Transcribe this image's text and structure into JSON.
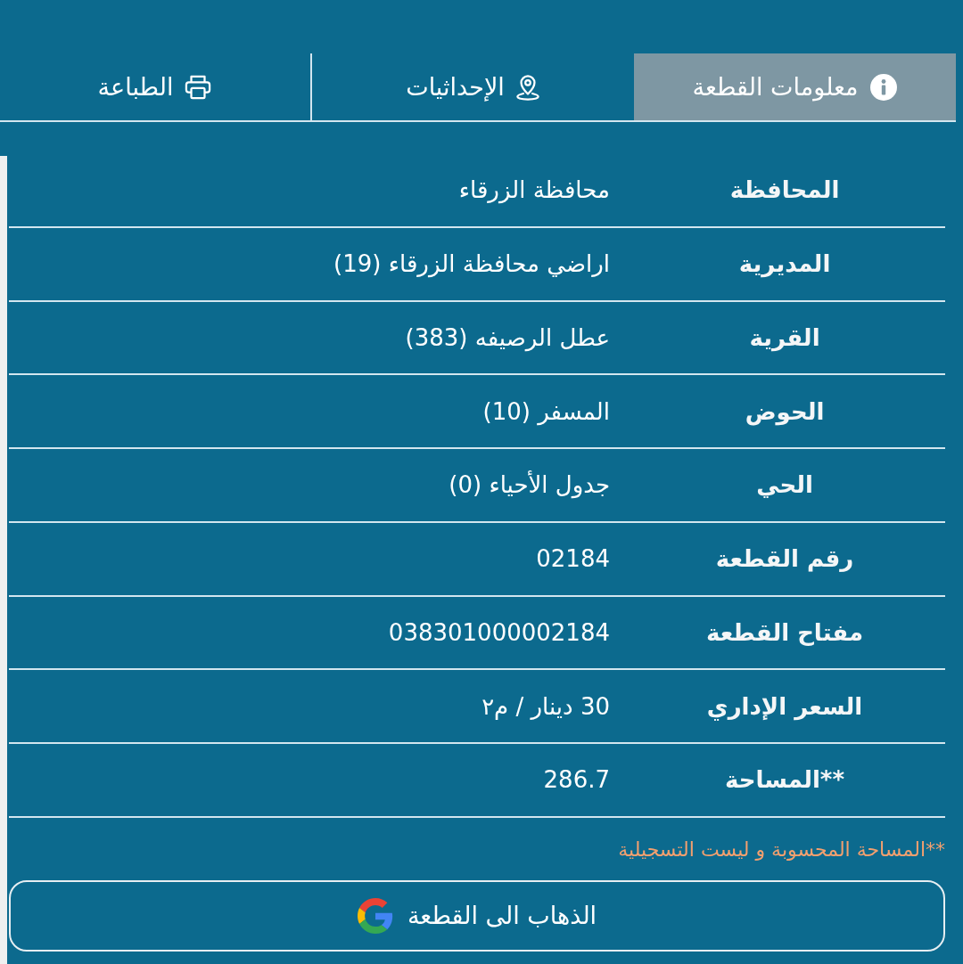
{
  "tabs": [
    {
      "label": "معلومات القطعة",
      "kind": "details",
      "selected": true
    },
    {
      "label": "الإحداثيات",
      "kind": "coordinates",
      "selected": false
    },
    {
      "label": "الطباعة",
      "kind": "print",
      "selected": false
    }
  ],
  "table": {
    "rows": [
      {
        "label": "المحافظة",
        "value": "محافظة الزرقاء"
      },
      {
        "label": "المديرية",
        "value": "اراضي محافظة الزرقاء (19)"
      },
      {
        "label": "القرية",
        "value": "عطل الرصيفه (383)"
      },
      {
        "label": "الحوض",
        "value": "المسفر (10)"
      },
      {
        "label": "الحي",
        "value": "جدول الأحياء (0)"
      },
      {
        "label": "رقم القطعة",
        "value": "02184"
      },
      {
        "label": "مفتاح القطعة",
        "value": "038301000002184"
      },
      {
        "label": "السعر الإداري",
        "value": "30 دينار / م٢"
      },
      {
        "label": "**المساحة",
        "value": "286.7"
      }
    ]
  },
  "footnote": "**المساحة المحسوبة و ليست التسجيلية",
  "button": {
    "label": "الذهاب الى القطعة"
  }
}
